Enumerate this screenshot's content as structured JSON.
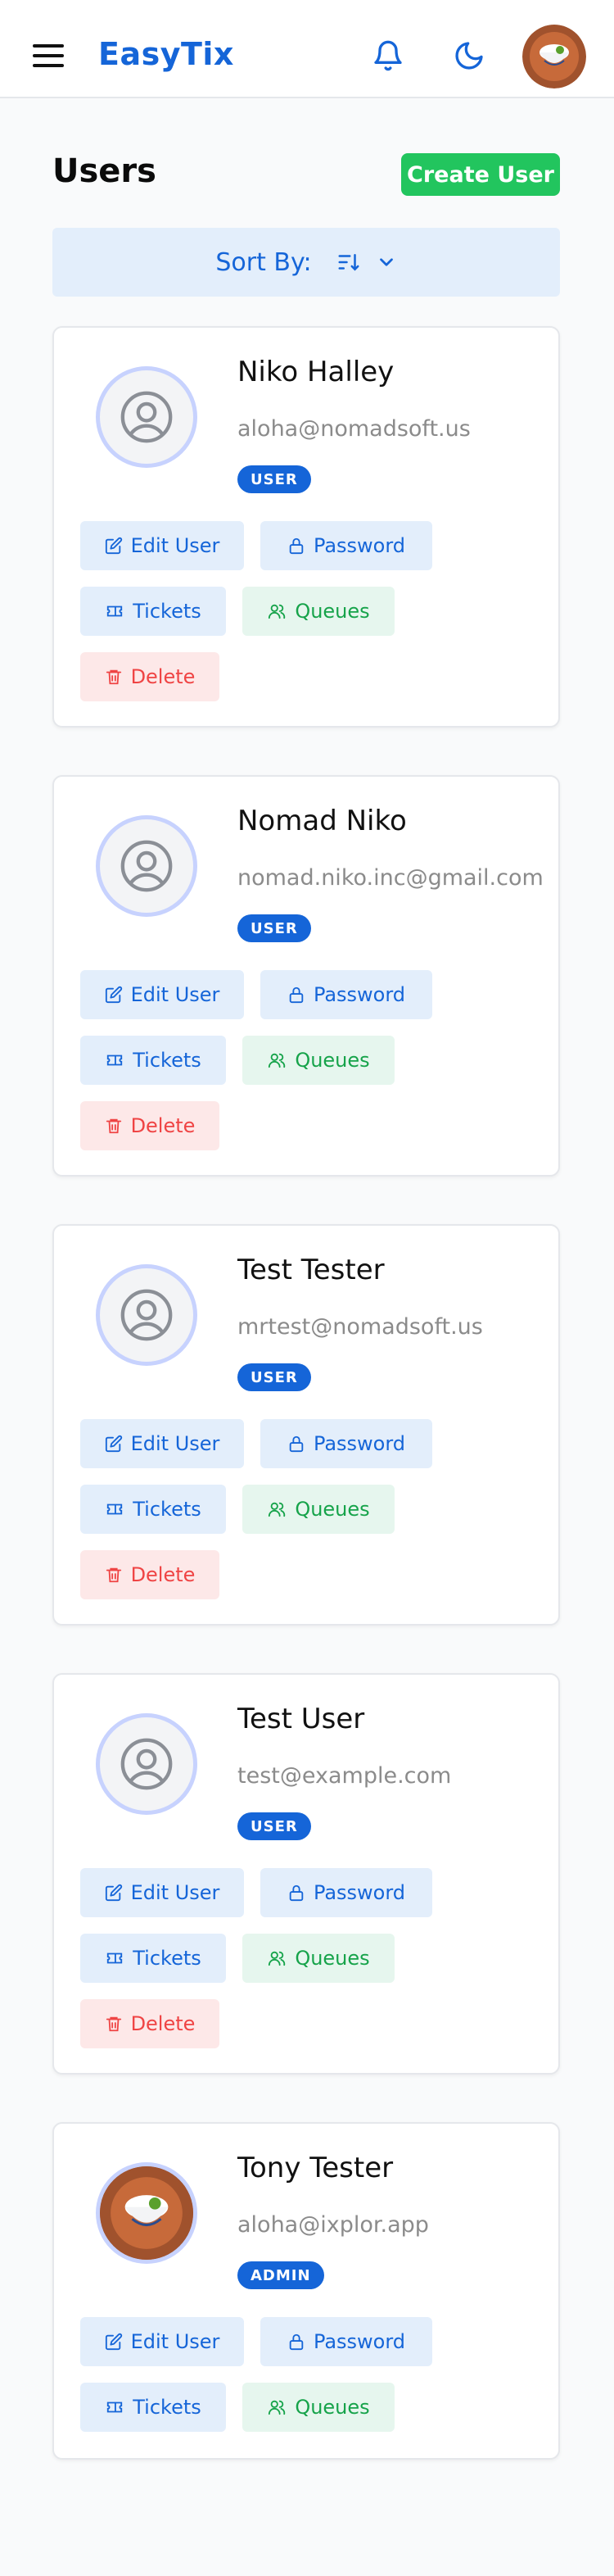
{
  "header": {
    "brand": "EasyTix"
  },
  "page": {
    "title": "Users",
    "create_label": "Create User",
    "sort_label": "Sort By:"
  },
  "actions": {
    "edit": "Edit User",
    "password": "Password",
    "tickets": "Tickets",
    "queues": "Queues",
    "delete": "Delete"
  },
  "users": [
    {
      "name": "Niko Halley",
      "email": "aloha@nomadsoft.us",
      "role": "USER"
    },
    {
      "name": "Nomad Niko",
      "email": "nomad.niko.inc@gmail.com",
      "role": "USER"
    },
    {
      "name": "Test Tester",
      "email": "mrtest@nomadsoft.us",
      "role": "USER"
    },
    {
      "name": "Test User",
      "email": "test@example.com",
      "role": "USER"
    },
    {
      "name": "Tony Tester",
      "email": "aloha@ixplor.app",
      "role": "ADMIN"
    }
  ],
  "colors": {
    "accent": "#1565d8",
    "success": "#22c55e",
    "danger": "#ef4444"
  }
}
